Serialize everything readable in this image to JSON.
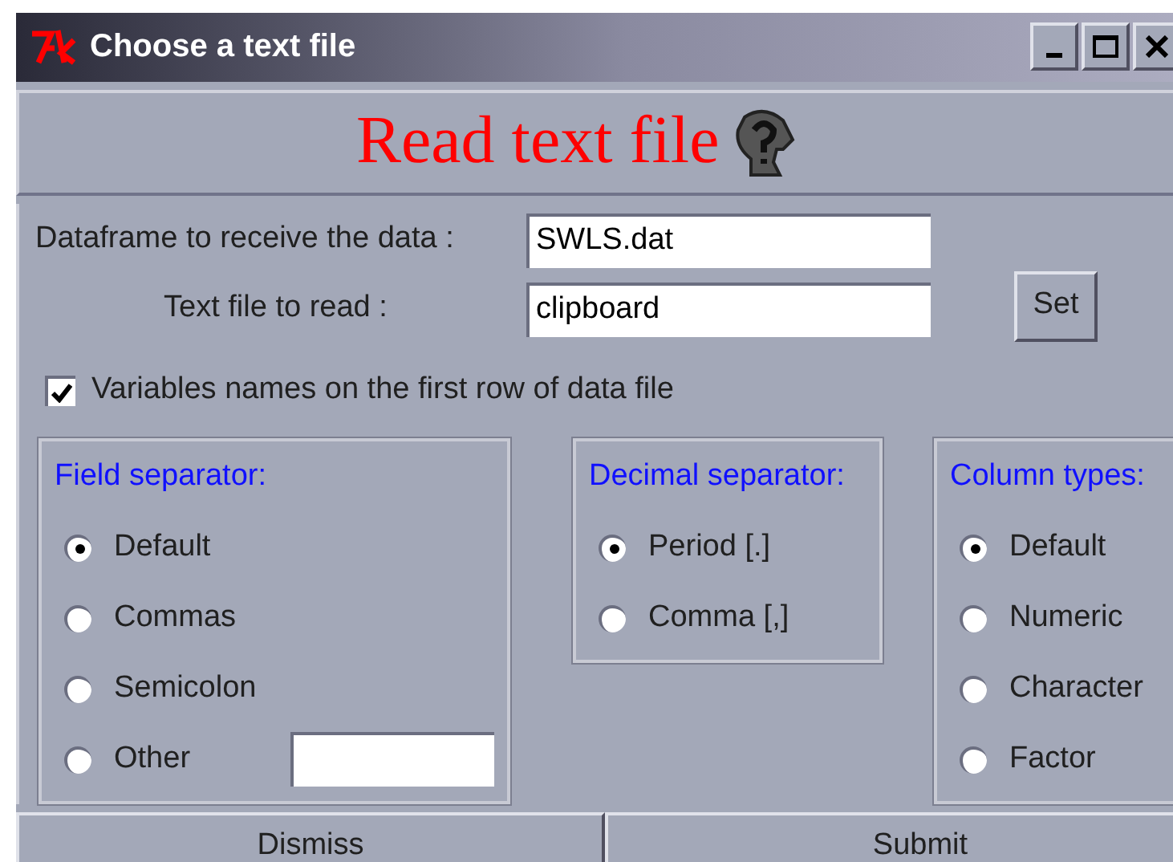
{
  "window": {
    "title": "Choose a text file"
  },
  "heading": "Read text file",
  "fields": [
    {
      "label": "Dataframe to receive the data :",
      "value": "SWLS.dat"
    },
    {
      "label": "Text file to read :",
      "value": "clipboard"
    }
  ],
  "set_button": "Set",
  "header_checkbox": {
    "label": "Variables names on the first row of data file",
    "checked": true
  },
  "groups": [
    {
      "title": "Field separator:",
      "options": [
        {
          "label": "Default",
          "selected": true
        },
        {
          "label": "Commas",
          "selected": false
        },
        {
          "label": "Semicolon",
          "selected": false
        },
        {
          "label": "Other",
          "selected": false,
          "kind": "entry"
        }
      ]
    },
    {
      "title": "Decimal separator:",
      "options": [
        {
          "label": "Period [.]",
          "selected": true
        },
        {
          "label": "Comma [,]",
          "selected": false
        }
      ]
    },
    {
      "title": "Column types:",
      "options": [
        {
          "label": "Default",
          "selected": true
        },
        {
          "label": "Numeric",
          "selected": false
        },
        {
          "label": "Character",
          "selected": false
        },
        {
          "label": "Factor",
          "selected": false
        }
      ]
    }
  ],
  "buttons": [
    "Dismiss",
    "Submit"
  ]
}
